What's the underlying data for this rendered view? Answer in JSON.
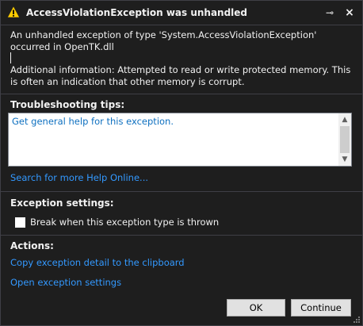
{
  "dialog": {
    "title": "AccessViolationException was unhandled",
    "pin_glyph": "⊸",
    "close_glyph": "×"
  },
  "message": {
    "line1": "An unhandled exception of type 'System.AccessViolationException' occurred in OpenTK.dll",
    "additional": "Additional information: Attempted to read or write protected memory. This is often an indication that other memory is corrupt."
  },
  "troubleshooting": {
    "heading": "Troubleshooting tips:",
    "tip_link": "Get general help for this exception."
  },
  "search_link": "Search for more Help Online...",
  "exception_settings": {
    "heading": "Exception settings:",
    "checkbox_label": "Break when this exception type is thrown",
    "checked": false
  },
  "actions": {
    "heading": "Actions:",
    "copy_link": "Copy exception detail to the clipboard",
    "open_link": "Open exception settings"
  },
  "buttons": {
    "ok": "OK",
    "continue": "Continue"
  },
  "colors": {
    "background": "#1e1e1e",
    "link": "#3399ff",
    "warning": "#ffcc00"
  },
  "icons": {
    "title_icon": "warning-icon",
    "pin": "pin-icon",
    "close": "close-icon"
  }
}
